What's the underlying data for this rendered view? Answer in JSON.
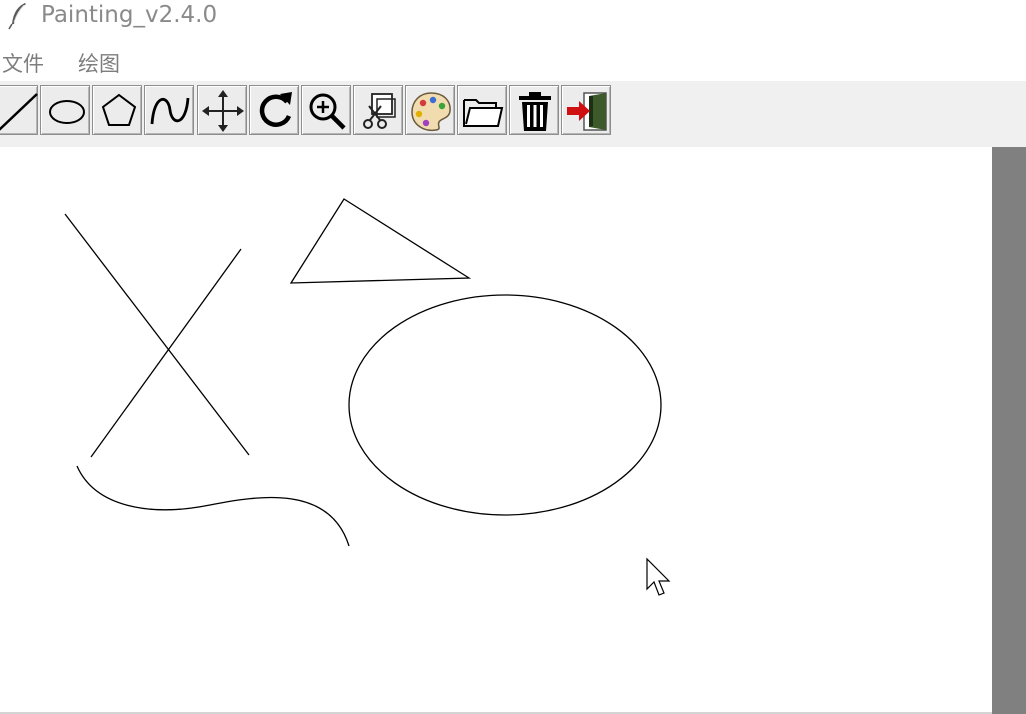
{
  "window": {
    "title": "Painting_v2.4.0",
    "icon": "feather-icon"
  },
  "menu": {
    "items": [
      {
        "label": "文件"
      },
      {
        "label": "绘图"
      }
    ]
  },
  "toolbar": {
    "tools": [
      {
        "name": "line-tool",
        "icon": "line-icon"
      },
      {
        "name": "ellipse-tool",
        "icon": "ellipse-icon"
      },
      {
        "name": "polygon-tool",
        "icon": "pentagon-icon"
      },
      {
        "name": "curve-tool",
        "icon": "curve-icon"
      },
      {
        "name": "move-tool",
        "icon": "move-arrows-icon"
      },
      {
        "name": "rotate-tool",
        "icon": "rotate-icon"
      },
      {
        "name": "zoom-tool",
        "icon": "zoom-in-icon"
      },
      {
        "name": "clip-tool",
        "icon": "scissors-clip-icon"
      },
      {
        "name": "color-tool",
        "icon": "palette-icon"
      },
      {
        "name": "open-tool",
        "icon": "folder-icon"
      },
      {
        "name": "clear-tool",
        "icon": "trash-icon"
      },
      {
        "name": "exit-tool",
        "icon": "exit-door-icon"
      }
    ]
  },
  "canvas": {
    "background": "#ffffff",
    "stroke_color": "#000000",
    "shapes": [
      "line",
      "line",
      "polygon",
      "ellipse",
      "curve"
    ]
  },
  "colors": {
    "toolbar_bg": "#f0f0f0",
    "scrollbar": "#808080",
    "menu_text": "#7d7d7d",
    "title_text": "#8a8a8a"
  }
}
